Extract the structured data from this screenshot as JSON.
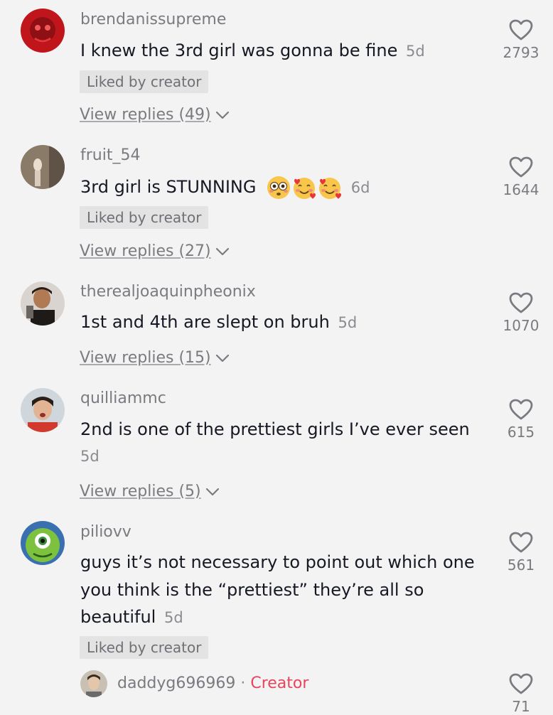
{
  "comments": [
    {
      "username": "brendanissupreme",
      "text": "I knew the 3rd girl was gonna be fine",
      "time": "5d",
      "liked_by_creator": "Liked by creator",
      "view_replies": "View replies (49)",
      "likes": "2793",
      "avatar_color": "#c0161b"
    },
    {
      "username": "fruit_54",
      "text": "3rd girl is STUNNING",
      "time": "6d",
      "liked_by_creator": "Liked by creator",
      "view_replies": "View replies (27)",
      "likes": "1644",
      "avatar_color": "#7b6a58"
    },
    {
      "username": "therealjoaquinpheonix",
      "text": "1st and 4th are slept on bruh",
      "time": "5d",
      "view_replies": "View replies (15)",
      "likes": "1070",
      "avatar_color": "#3a2a22"
    },
    {
      "username": "quilliammc",
      "text": "2nd is one of the prettiest girls I’ve ever seen",
      "time": "5d",
      "view_replies": "View replies (5)",
      "likes": "615",
      "avatar_color": "#d23a2e"
    },
    {
      "username": "piliovv",
      "text_lines": [
        "guys it’s not necessary to point out which one",
        "you think is the “prettiest” they’re all so",
        "beautiful"
      ],
      "time": "5d",
      "liked_by_creator": "Liked by creator",
      "likes": "561",
      "avatar_color": "#6fb23a"
    }
  ],
  "reply": {
    "username": "daddyg696969",
    "separator": "·",
    "creator_label": "Creator",
    "likes": "71",
    "avatar_color": "#b9ae9c"
  },
  "colors": {
    "background": "#f3f3f3",
    "creator_red": "#e8455c",
    "text_primary": "#161823",
    "text_secondary": "#7a7b80"
  }
}
